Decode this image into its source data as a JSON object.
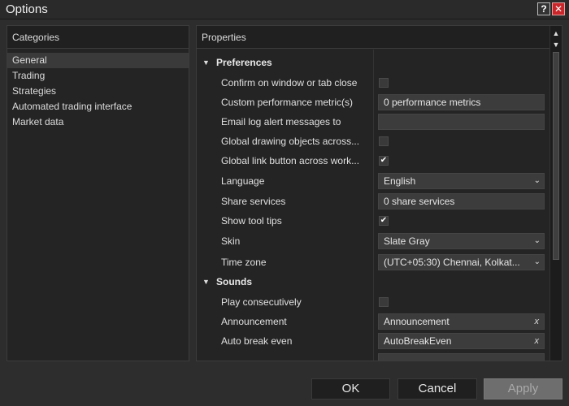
{
  "window": {
    "title": "Options",
    "help_glyph": "?",
    "close_glyph": "✕"
  },
  "categories": {
    "header": "Categories",
    "items": [
      "General",
      "Trading",
      "Strategies",
      "Automated trading interface",
      "Market data"
    ]
  },
  "properties": {
    "header": "Properties",
    "sections": {
      "preferences": "Preferences",
      "sounds": "Sounds"
    },
    "rows": {
      "confirm_close": {
        "label": "Confirm on window or tab close",
        "checked": false
      },
      "custom_metric": {
        "label": "Custom performance metric(s)",
        "value": "0 performance metrics"
      },
      "email_log": {
        "label": "Email log alert messages to",
        "value": ""
      },
      "global_drawing": {
        "label": "Global drawing objects across...",
        "checked": false
      },
      "global_link": {
        "label": "Global link button across work...",
        "checked": true
      },
      "language": {
        "label": "Language",
        "value": "English"
      },
      "share_services": {
        "label": "Share services",
        "value": "0 share services"
      },
      "show_tooltips": {
        "label": "Show tool tips",
        "checked": true
      },
      "skin": {
        "label": "Skin",
        "value": "Slate Gray"
      },
      "time_zone": {
        "label": "Time zone",
        "value": "(UTC+05:30) Chennai, Kolkat..."
      },
      "play_consecutively": {
        "label": "Play consecutively",
        "checked": false
      },
      "announcement": {
        "label": "Announcement",
        "value": "Announcement"
      },
      "auto_break_even": {
        "label": "Auto break even",
        "value": "AutoBreakEven"
      }
    }
  },
  "buttons": {
    "ok": "OK",
    "cancel": "Cancel",
    "apply": "Apply"
  },
  "glyphs": {
    "caret_down": "▼",
    "chevron": "⌄",
    "check": "✔",
    "clear": "x",
    "scroll_up": "▲",
    "scroll_down": "▼"
  }
}
